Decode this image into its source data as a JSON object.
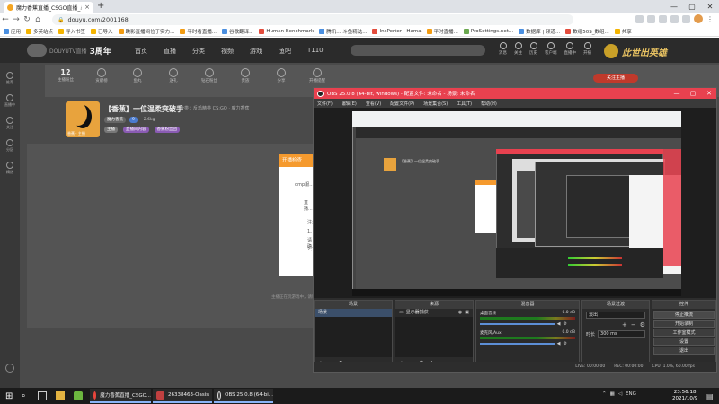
{
  "browser": {
    "tab_title": "魔力香蕉直播_CSGO直播_斗鱼...",
    "url": "douyu.com/2001168",
    "bookmarks": [
      "应用",
      "多英站点",
      "导入书签",
      "已导入",
      "跳影直播间位于实力...",
      "平时看直播...",
      "谷歌翻译...",
      "Human Benchmark",
      "腾讯... 斗鱼精选...",
      "InsPerter | Hama",
      "平时直播...",
      "ProSettings.net...",
      "数据库 | 频道...",
      "数组50S_数组...",
      "共享"
    ]
  },
  "douyu": {
    "logo_text": "DOUYUTV直播",
    "logo_sub": "3周年",
    "nav": [
      "首页",
      "直播",
      "分类",
      "视频",
      "游戏",
      "鱼吧",
      "T110"
    ],
    "header_icons": [
      "消息",
      "关注",
      "历史",
      "客户端",
      "直播中",
      "开播"
    ],
    "banner_text": "此世出英雄",
    "sidebar": [
      "推荐",
      "直播中",
      "关注",
      "分区",
      "精选"
    ],
    "stats": [
      {
        "num": "12",
        "label": "主播粉丝"
      },
      {
        "num": "",
        "label": "贡献榜"
      },
      {
        "num": "",
        "label": "鱼丸"
      },
      {
        "num": "",
        "label": "送礼"
      },
      {
        "num": "",
        "label": "钻石粉丝"
      },
      {
        "num": "",
        "label": "贵族"
      },
      {
        "num": "",
        "label": "分享"
      },
      {
        "num": "",
        "label": "开播提醒"
      }
    ],
    "subscribe": "关注主播",
    "room_title": "【香蕉】一位温柔突破手",
    "room_category": "分类：反恐精英 CS:GO · 魔力香蕉",
    "owner": "魔力香蕉",
    "owner_level": "9",
    "hot": "2.6kg",
    "tags": [
      "主播",
      "直播间内容",
      "香蕉粉丝团"
    ],
    "thumb_label": "香蕉 · 主播",
    "popup_title": "开播检查",
    "popup_lines": [
      "dmp服...",
      "直播...",
      "注:",
      "1、",
      "请确...",
      "2、"
    ],
    "footer": "主播正在玩游戏中，请稍后..."
  },
  "obs": {
    "title": "OBS 25.0.8 (64-bit, windows) - 配置文件: 未命名 - 场景: 未命名",
    "menu": [
      "文件(F)",
      "编辑(E)",
      "查看(V)",
      "配置文件(P)",
      "场景集合(S)",
      "工具(T)",
      "帮助(H)"
    ],
    "docks": {
      "scenes": {
        "title": "场景",
        "items": [
          "场景"
        ]
      },
      "sources": {
        "title": "来源",
        "items": [
          "显示器捕获"
        ]
      },
      "mixer": {
        "title": "混音器",
        "channels": [
          {
            "name": "桌面音频",
            "level": "0.0 dB"
          },
          {
            "name": "麦克风/Aux",
            "level": "0.0 dB"
          }
        ]
      },
      "transitions": {
        "title": "场景过渡",
        "type": "淡出",
        "duration_label": "时长",
        "duration": "300 ms"
      },
      "controls": {
        "title": "控件",
        "buttons": [
          "停止推流",
          "开始录制",
          "工作室模式",
          "设置",
          "退出"
        ]
      }
    },
    "status": [
      "LIVE: 00:00:00",
      "REC: 00:00:00",
      "CPU: 1.0%, 60.00 fps"
    ]
  },
  "taskbar": {
    "apps": [
      {
        "label": "魔力香蕉直播_CSGO...",
        "color": "#f5a623"
      },
      {
        "label": "26338463-Oasis",
        "color": "#c04040"
      },
      {
        "label": "OBS 25.0.8 (64-bi...",
        "color": "#444444"
      }
    ],
    "tray_lang": "ENG",
    "time": "23:56:18",
    "date": "2021/10/9"
  }
}
